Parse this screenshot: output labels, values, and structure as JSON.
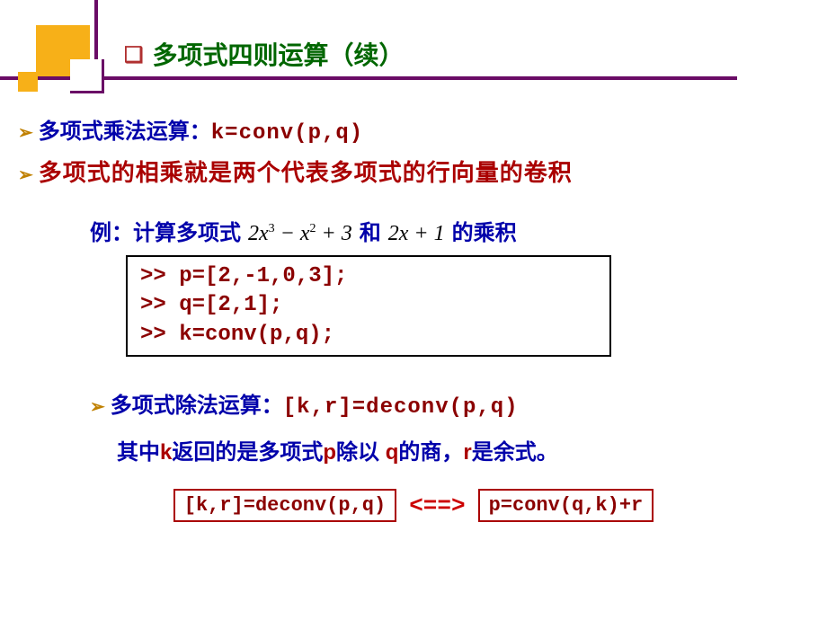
{
  "title": "多项式四则运算（续）",
  "line1": {
    "label": "多项式乘法运算：",
    "code": "k=conv(p,q)"
  },
  "line2": "多项式的相乘就是两个代表多项式的行向量的卷积",
  "example": {
    "pre": "例：计算多项式",
    "math1_html": "2<i>x</i><sup>3</sup> − <i>x</i><sup>2</sup> + 3",
    "mid": "和",
    "math2_html": "2<i>x</i> + 1",
    "post": "的乘积"
  },
  "code_block": ">> p=[2,-1,0,3];\n>> q=[2,1];\n>> k=conv(p,q);",
  "line3": {
    "label": "多项式除法运算：",
    "code": "[k,r]=deconv(p,q)"
  },
  "desc": {
    "t1": "其中",
    "k1": "k",
    "t2": "返回的是多项式",
    "k2": "p",
    "t3": "除以 ",
    "k3": "q",
    "t4": "的商，",
    "k4": "r",
    "t5": "是余式。"
  },
  "equiv": {
    "left": "[k,r]=deconv(p,q)",
    "mid": "<==>",
    "right": "p=conv(q,k)+r"
  }
}
